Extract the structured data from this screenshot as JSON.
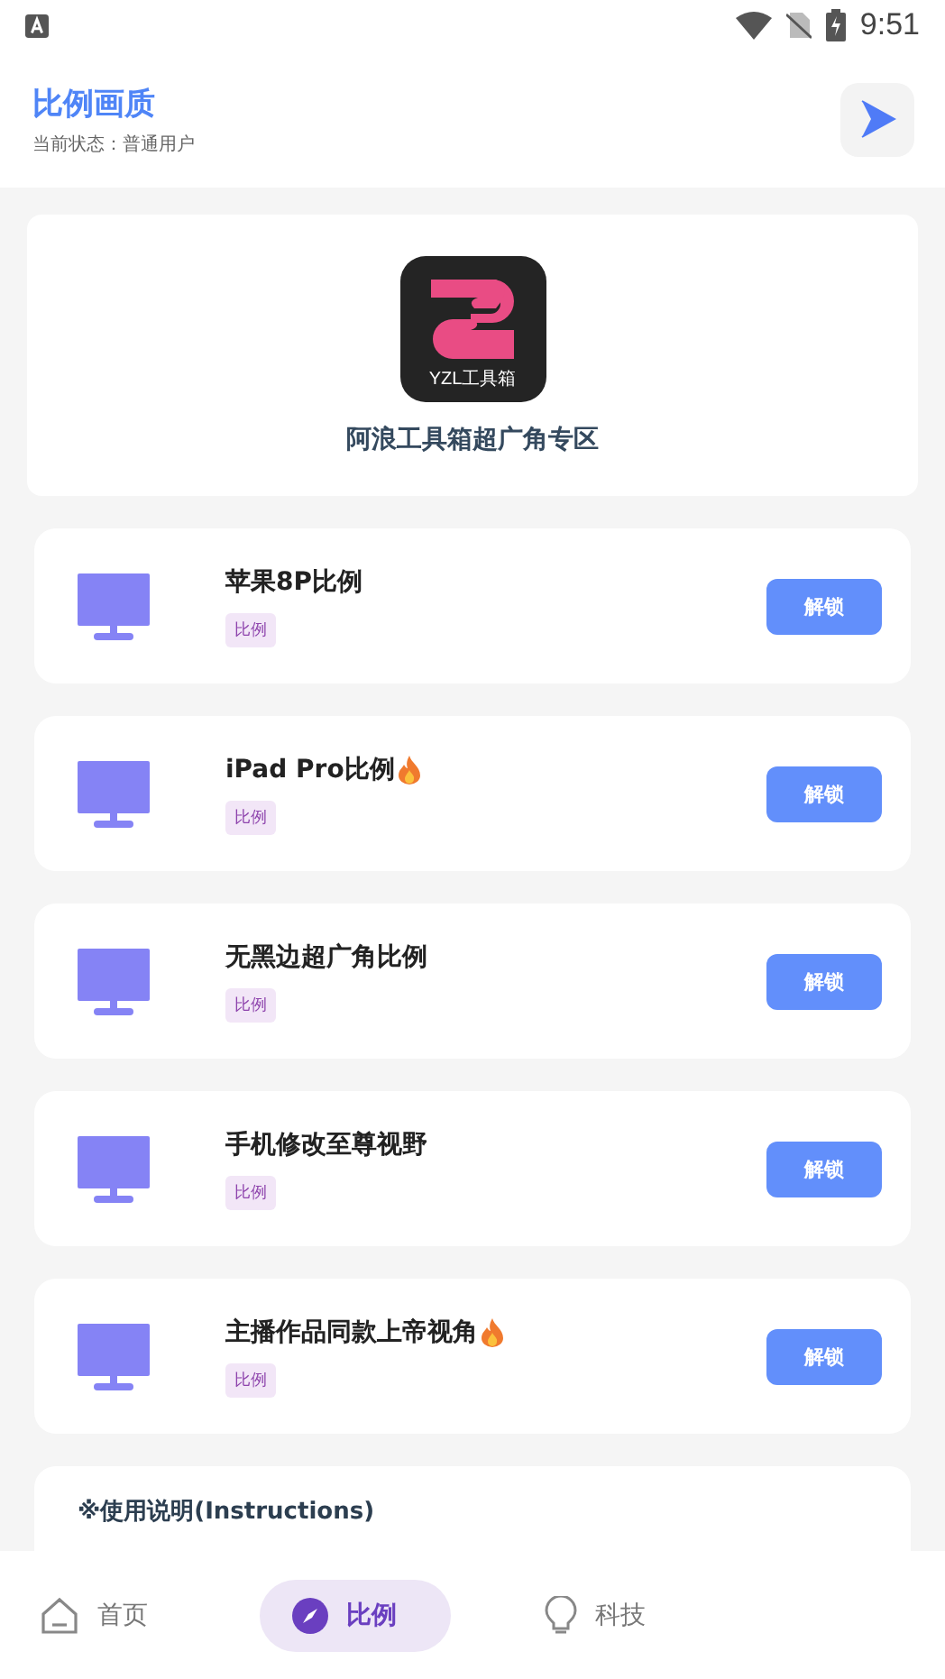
{
  "status_bar": {
    "time": "9:51"
  },
  "header": {
    "title": "比例画质",
    "subtitle": "当前状态：普通用户"
  },
  "hero": {
    "logo_text": "YZL工具箱",
    "title": "阿浪工具箱超广角专区"
  },
  "items": [
    {
      "title": "苹果8P比例",
      "hot": false,
      "tag": "比例",
      "button": "解锁"
    },
    {
      "title": "iPad Pro比例",
      "hot": true,
      "tag": "比例",
      "button": "解锁"
    },
    {
      "title": "无黑边超广角比例",
      "hot": false,
      "tag": "比例",
      "button": "解锁"
    },
    {
      "title": "手机修改至尊视野",
      "hot": false,
      "tag": "比例",
      "button": "解锁"
    },
    {
      "title": "主播作品同款上帝视角",
      "hot": true,
      "tag": "比例",
      "button": "解锁"
    }
  ],
  "instructions": {
    "title": "※使用说明(Instructions)"
  },
  "nav": [
    {
      "label": "首页",
      "kind": "home",
      "selected": false
    },
    {
      "label": "比例",
      "kind": "compass",
      "selected": true
    },
    {
      "label": "科技",
      "kind": "bulb",
      "selected": false
    }
  ]
}
